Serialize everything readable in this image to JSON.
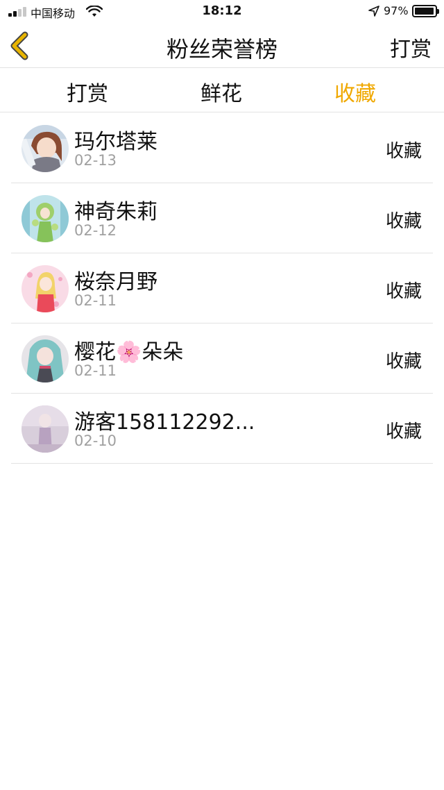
{
  "status_bar": {
    "carrier": "中国移动",
    "time": "18:12",
    "battery_percent": "97%",
    "battery_level": 0.97,
    "signal_bars_filled": 2,
    "icons": [
      "signal-icon",
      "wifi-icon",
      "location-arrow-icon",
      "battery-icon"
    ]
  },
  "nav": {
    "back_icon": "chevron-left-icon",
    "title": "粉丝荣誉榜",
    "right_action": "打赏"
  },
  "tabs": [
    {
      "label": "打赏",
      "active": false
    },
    {
      "label": "鲜花",
      "active": false
    },
    {
      "label": "收藏",
      "active": true
    }
  ],
  "colors": {
    "accent": "#f0a800",
    "back_icon": "#e8b400",
    "divider": "#e2e2e2",
    "secondary_text": "#a0a0a0"
  },
  "fans": [
    {
      "name": "玛尔塔莱",
      "date": "02-13",
      "action": "收藏"
    },
    {
      "name": "神奇朱莉",
      "date": "02-12",
      "action": "收藏"
    },
    {
      "name": "桜奈月野",
      "date": "02-11",
      "action": "收藏"
    },
    {
      "name": "樱花🌸朵朵",
      "date": "02-11",
      "action": "收藏"
    },
    {
      "name": "游客158112292...",
      "date": "02-10",
      "action": "收藏"
    }
  ]
}
